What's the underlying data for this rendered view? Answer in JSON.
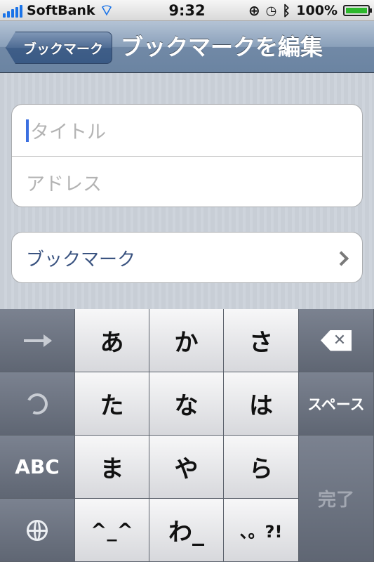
{
  "status_bar": {
    "carrier": "SoftBank",
    "time": "9:32",
    "battery": "100%"
  },
  "nav": {
    "back_label": "ブックマーク",
    "title": "ブックマークを編集"
  },
  "form": {
    "title_placeholder": "タイトル",
    "address_placeholder": "アドレス",
    "folder_label": "ブックマーク"
  },
  "keyboard": {
    "row1": [
      "あ",
      "か",
      "さ"
    ],
    "row2": [
      "た",
      "な",
      "は"
    ],
    "row3": [
      "ま",
      "や",
      "ら"
    ],
    "row4": [
      "^_^",
      "わ_",
      "、。?!"
    ],
    "abc_label": "ABC",
    "space_label": "スペース",
    "done_label": "完了"
  },
  "icons": {
    "signal": "signal-bars-icon",
    "wifi": "wifi-icon",
    "rotation_lock": "rotation-lock-icon",
    "alarm": "alarm-icon",
    "bluetooth": "bluetooth-icon",
    "battery": "battery-icon",
    "next": "arrow-right-icon",
    "undo": "undo-icon",
    "globe": "globe-icon",
    "delete": "backspace-icon",
    "disclosure": "chevron-right-icon"
  },
  "colors": {
    "caret": "#3b6fe0",
    "battery_fill": "#2db82d",
    "nav_gradient_top": "#b4c3d5"
  }
}
